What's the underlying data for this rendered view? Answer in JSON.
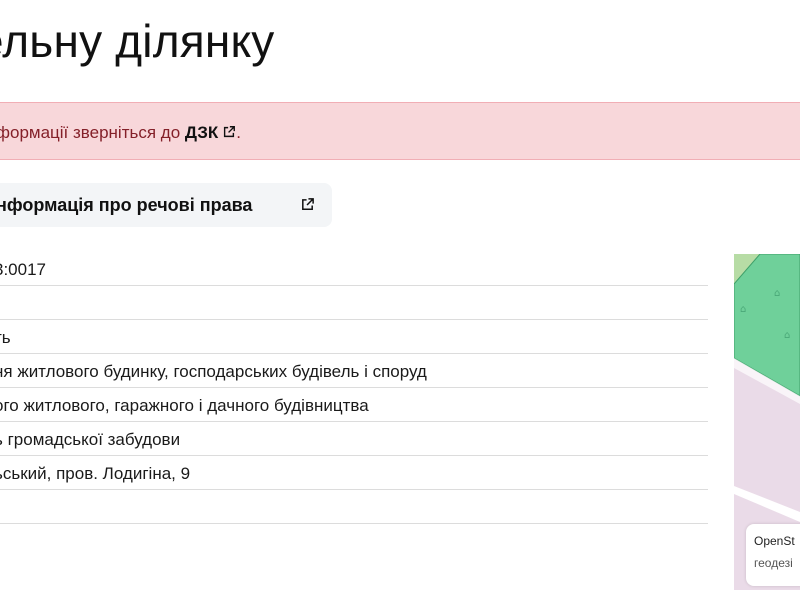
{
  "header": {
    "title": "ельну ділянку"
  },
  "alert": {
    "text_before": "формації зверніться до ",
    "link_label": "ДЗК",
    "text_after": "."
  },
  "rights_button": {
    "label": "нформація про речові права"
  },
  "parcel_info": {
    "rows": [
      {
        "value": "3:0017"
      },
      {
        "value": ""
      },
      {
        "value": "ть"
      },
      {
        "value": "ня житлового будинку, господарських будівель і споруд"
      },
      {
        "value": "ого житлового, гаражного і дачного будівництва"
      },
      {
        "value": "ь громадської забудови"
      },
      {
        "value": "ьський, пров. Лодигіна, 9"
      },
      {
        "value": ""
      }
    ]
  },
  "map": {
    "attribution_line1": "OpenSt",
    "attribution_line2": "геодезі",
    "colors": {
      "parcel": "#6fd09a",
      "residential": "#eadbe8",
      "green": "#b7dca5"
    }
  },
  "colors": {
    "alert_bg": "#f8d7da",
    "alert_text": "#842029",
    "button_bg": "#f3f5f7"
  }
}
